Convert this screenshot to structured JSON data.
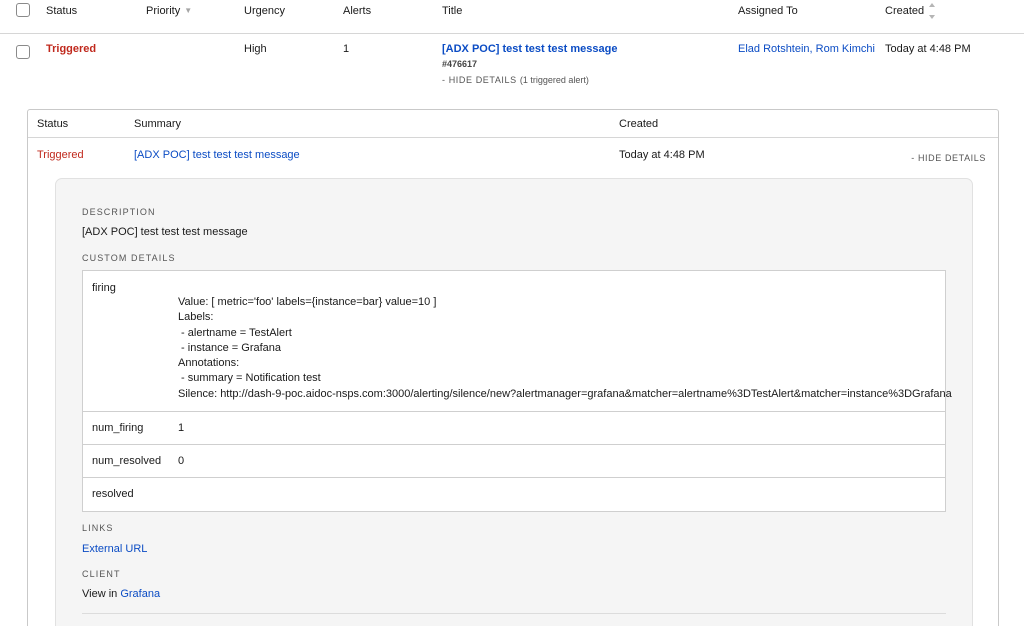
{
  "table": {
    "headers": {
      "status": "Status",
      "priority": "Priority",
      "urgency": "Urgency",
      "alerts": "Alerts",
      "title": "Title",
      "assigned_to": "Assigned To",
      "created": "Created"
    }
  },
  "incident": {
    "status": "Triggered",
    "urgency": "High",
    "alerts": "1",
    "title": "[ADX POC] test test test message",
    "number": "#476617",
    "hide_details": "- HIDE DETAILS",
    "hide_details_note": "(1 triggered alert)",
    "assignees": "Elad Rotshtein, Rom Kimchi",
    "created": "Today at 4:48 PM"
  },
  "alerts_panel": {
    "headers": {
      "status": "Status",
      "summary": "Summary",
      "created": "Created"
    },
    "alert": {
      "status": "Triggered",
      "summary": "[ADX POC] test test test message",
      "created": "Today at 4:48 PM",
      "hide_details": "- HIDE DETAILS"
    },
    "details": {
      "description_label": "DESCRIPTION",
      "description": "[ADX POC] test test test message",
      "custom_details_label": "CUSTOM DETAILS",
      "custom_details": {
        "firing_key": "firing",
        "firing_lines": [
          "Value: [ metric='foo' labels={instance=bar} value=10 ]",
          "Labels:",
          " - alertname = TestAlert",
          " - instance = Grafana",
          "Annotations:",
          " - summary = Notification test",
          "Silence: http://dash-9-poc.aidoc-nsps.com:3000/alerting/silence/new?alertmanager=grafana&matcher=alertname%3DTestAlert&matcher=instance%3DGrafana"
        ],
        "num_firing_key": "num_firing",
        "num_firing_value": "1",
        "num_resolved_key": "num_resolved",
        "num_resolved_value": "0",
        "resolved_key": "resolved",
        "resolved_value": ""
      },
      "links_label": "LINKS",
      "external_url": "External URL",
      "client_label": "CLIENT",
      "client_prefix": "View in",
      "client_link": "Grafana"
    }
  },
  "colors": {
    "triggered": "#c0291d",
    "link": "#0b4cc4"
  }
}
